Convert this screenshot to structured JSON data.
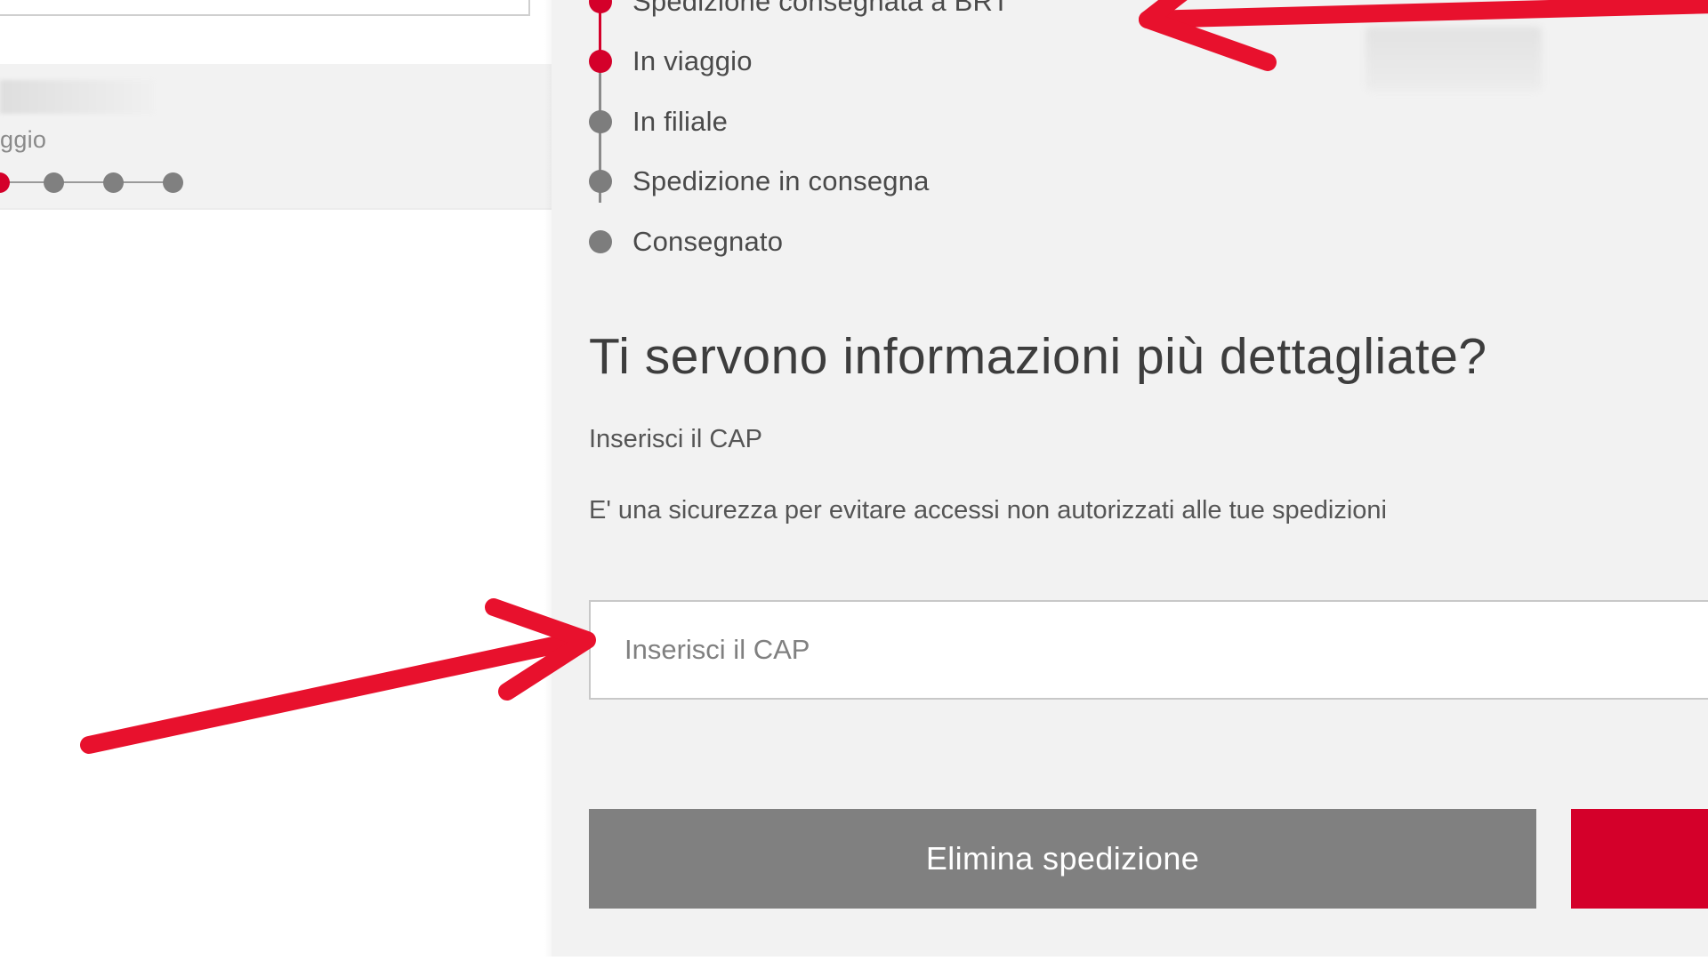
{
  "colors": {
    "brand_red": "#d4002a",
    "panel_bg": "#f2f2f2",
    "inactive_dot": "#7d7d7d",
    "button_gray": "#808080",
    "annotation_arrow": "#e8112d"
  },
  "left_card": {
    "status_text": "ggio",
    "progress_step": 1,
    "progress_total": 4
  },
  "tracking": {
    "steps": [
      {
        "label": "Spedizione consegnata a BRT",
        "state": "done"
      },
      {
        "label": "In viaggio",
        "state": "current"
      },
      {
        "label": "In filiale",
        "state": "pending"
      },
      {
        "label": "Spedizione in consegna",
        "state": "pending"
      },
      {
        "label": "Consegnato",
        "state": "pending"
      }
    ]
  },
  "details": {
    "heading": "Ti servono informazioni più dettagliate?",
    "cap_label": "Inserisci il CAP",
    "security_note": "E' una sicurezza per evitare accessi non autorizzati alle tue spedizioni",
    "cap_input": {
      "placeholder": "Inserisci il CAP",
      "value": ""
    }
  },
  "actions": {
    "delete_label": "Elimina spedizione",
    "primary_label": ""
  }
}
